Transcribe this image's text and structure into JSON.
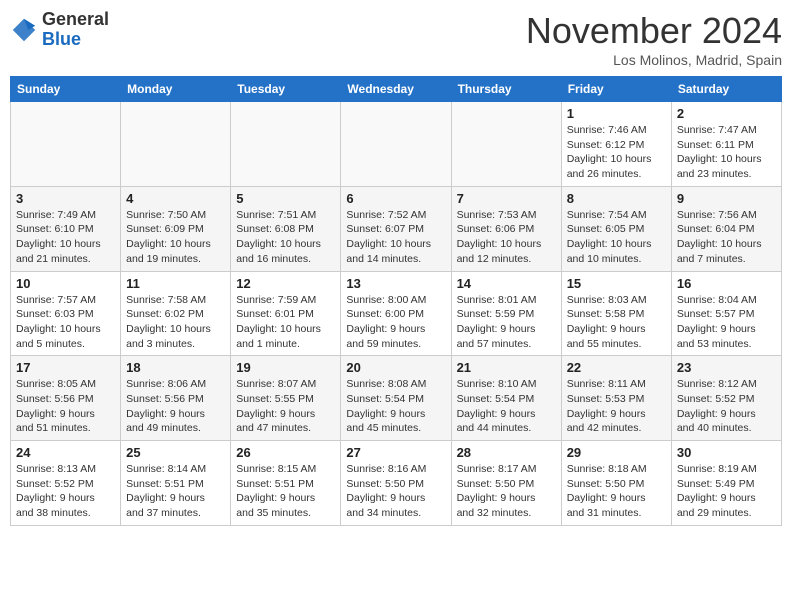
{
  "header": {
    "logo_general": "General",
    "logo_blue": "Blue",
    "month_title": "November 2024",
    "location": "Los Molinos, Madrid, Spain"
  },
  "weekdays": [
    "Sunday",
    "Monday",
    "Tuesday",
    "Wednesday",
    "Thursday",
    "Friday",
    "Saturday"
  ],
  "weeks": [
    [
      {
        "day": "",
        "info": ""
      },
      {
        "day": "",
        "info": ""
      },
      {
        "day": "",
        "info": ""
      },
      {
        "day": "",
        "info": ""
      },
      {
        "day": "",
        "info": ""
      },
      {
        "day": "1",
        "info": "Sunrise: 7:46 AM\nSunset: 6:12 PM\nDaylight: 10 hours and 26 minutes."
      },
      {
        "day": "2",
        "info": "Sunrise: 7:47 AM\nSunset: 6:11 PM\nDaylight: 10 hours and 23 minutes."
      }
    ],
    [
      {
        "day": "3",
        "info": "Sunrise: 7:49 AM\nSunset: 6:10 PM\nDaylight: 10 hours and 21 minutes."
      },
      {
        "day": "4",
        "info": "Sunrise: 7:50 AM\nSunset: 6:09 PM\nDaylight: 10 hours and 19 minutes."
      },
      {
        "day": "5",
        "info": "Sunrise: 7:51 AM\nSunset: 6:08 PM\nDaylight: 10 hours and 16 minutes."
      },
      {
        "day": "6",
        "info": "Sunrise: 7:52 AM\nSunset: 6:07 PM\nDaylight: 10 hours and 14 minutes."
      },
      {
        "day": "7",
        "info": "Sunrise: 7:53 AM\nSunset: 6:06 PM\nDaylight: 10 hours and 12 minutes."
      },
      {
        "day": "8",
        "info": "Sunrise: 7:54 AM\nSunset: 6:05 PM\nDaylight: 10 hours and 10 minutes."
      },
      {
        "day": "9",
        "info": "Sunrise: 7:56 AM\nSunset: 6:04 PM\nDaylight: 10 hours and 7 minutes."
      }
    ],
    [
      {
        "day": "10",
        "info": "Sunrise: 7:57 AM\nSunset: 6:03 PM\nDaylight: 10 hours and 5 minutes."
      },
      {
        "day": "11",
        "info": "Sunrise: 7:58 AM\nSunset: 6:02 PM\nDaylight: 10 hours and 3 minutes."
      },
      {
        "day": "12",
        "info": "Sunrise: 7:59 AM\nSunset: 6:01 PM\nDaylight: 10 hours and 1 minute."
      },
      {
        "day": "13",
        "info": "Sunrise: 8:00 AM\nSunset: 6:00 PM\nDaylight: 9 hours and 59 minutes."
      },
      {
        "day": "14",
        "info": "Sunrise: 8:01 AM\nSunset: 5:59 PM\nDaylight: 9 hours and 57 minutes."
      },
      {
        "day": "15",
        "info": "Sunrise: 8:03 AM\nSunset: 5:58 PM\nDaylight: 9 hours and 55 minutes."
      },
      {
        "day": "16",
        "info": "Sunrise: 8:04 AM\nSunset: 5:57 PM\nDaylight: 9 hours and 53 minutes."
      }
    ],
    [
      {
        "day": "17",
        "info": "Sunrise: 8:05 AM\nSunset: 5:56 PM\nDaylight: 9 hours and 51 minutes."
      },
      {
        "day": "18",
        "info": "Sunrise: 8:06 AM\nSunset: 5:56 PM\nDaylight: 9 hours and 49 minutes."
      },
      {
        "day": "19",
        "info": "Sunrise: 8:07 AM\nSunset: 5:55 PM\nDaylight: 9 hours and 47 minutes."
      },
      {
        "day": "20",
        "info": "Sunrise: 8:08 AM\nSunset: 5:54 PM\nDaylight: 9 hours and 45 minutes."
      },
      {
        "day": "21",
        "info": "Sunrise: 8:10 AM\nSunset: 5:54 PM\nDaylight: 9 hours and 44 minutes."
      },
      {
        "day": "22",
        "info": "Sunrise: 8:11 AM\nSunset: 5:53 PM\nDaylight: 9 hours and 42 minutes."
      },
      {
        "day": "23",
        "info": "Sunrise: 8:12 AM\nSunset: 5:52 PM\nDaylight: 9 hours and 40 minutes."
      }
    ],
    [
      {
        "day": "24",
        "info": "Sunrise: 8:13 AM\nSunset: 5:52 PM\nDaylight: 9 hours and 38 minutes."
      },
      {
        "day": "25",
        "info": "Sunrise: 8:14 AM\nSunset: 5:51 PM\nDaylight: 9 hours and 37 minutes."
      },
      {
        "day": "26",
        "info": "Sunrise: 8:15 AM\nSunset: 5:51 PM\nDaylight: 9 hours and 35 minutes."
      },
      {
        "day": "27",
        "info": "Sunrise: 8:16 AM\nSunset: 5:50 PM\nDaylight: 9 hours and 34 minutes."
      },
      {
        "day": "28",
        "info": "Sunrise: 8:17 AM\nSunset: 5:50 PM\nDaylight: 9 hours and 32 minutes."
      },
      {
        "day": "29",
        "info": "Sunrise: 8:18 AM\nSunset: 5:50 PM\nDaylight: 9 hours and 31 minutes."
      },
      {
        "day": "30",
        "info": "Sunrise: 8:19 AM\nSunset: 5:49 PM\nDaylight: 9 hours and 29 minutes."
      }
    ]
  ]
}
